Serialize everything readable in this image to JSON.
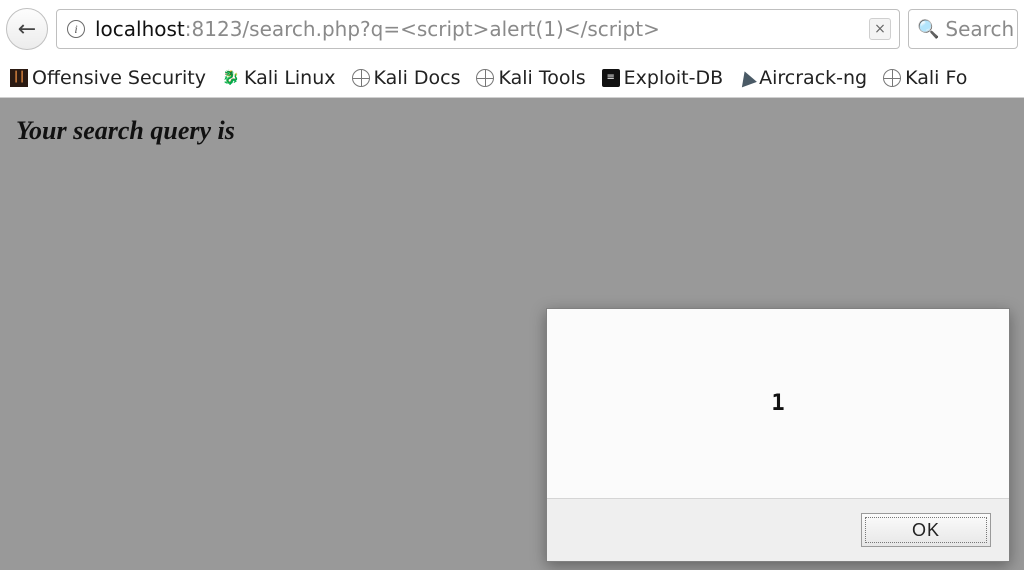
{
  "nav": {
    "back_symbol": "←",
    "info_symbol": "i",
    "url_host": "localhost",
    "url_rest": ":8123/search.php?q=<script>alert(1)</script>",
    "clear_symbol": "×",
    "search_placeholder": "Search",
    "search_icon": "🔍"
  },
  "bookmarks": [
    {
      "label": "Offensive Security",
      "icon": "offsec"
    },
    {
      "label": "Kali Linux",
      "icon": "kali"
    },
    {
      "label": "Kali Docs",
      "icon": "globe"
    },
    {
      "label": "Kali Tools",
      "icon": "globe"
    },
    {
      "label": "Exploit-DB",
      "icon": "exploit"
    },
    {
      "label": "Aircrack-ng",
      "icon": "aircrack"
    },
    {
      "label": "Kali Fo",
      "icon": "globe"
    }
  ],
  "page": {
    "heading": "Your search query is"
  },
  "alert": {
    "message": "1",
    "ok_label": "OK"
  }
}
